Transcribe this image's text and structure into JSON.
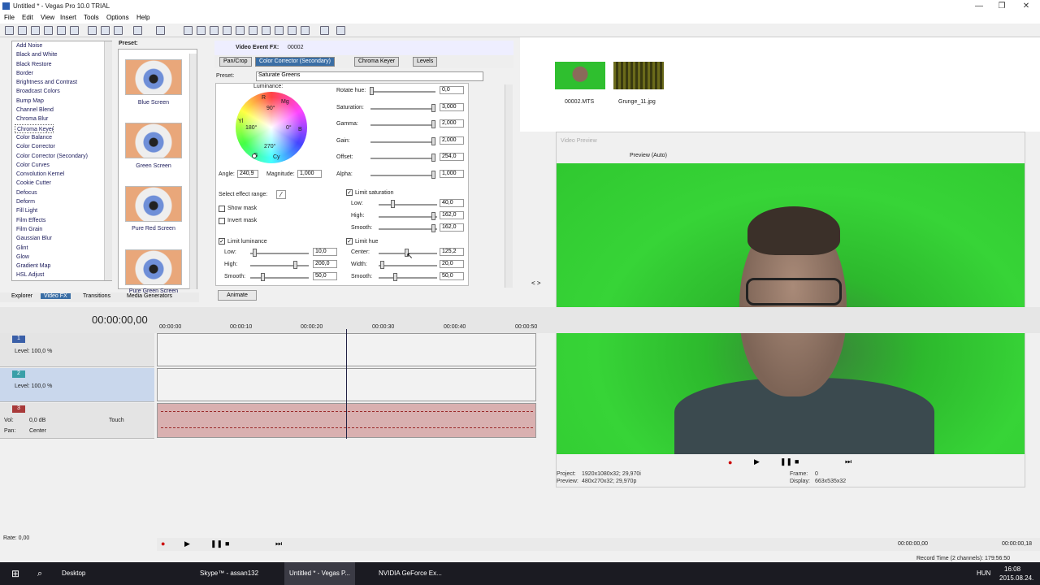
{
  "window": {
    "title": "Untitled * - Vegas Pro 10.0 TRIAL",
    "controls": [
      "—",
      "❐",
      "✕"
    ]
  },
  "menu": [
    "File",
    "Edit",
    "View",
    "Insert",
    "Tools",
    "Options",
    "Help"
  ],
  "fx_list": [
    "Add Noise",
    "Black and White",
    "Black Restore",
    "Border",
    "Brightness and Contrast",
    "Broadcast Colors",
    "Bump Map",
    "Channel Blend",
    "Chroma Blur",
    "Chroma Keyer",
    "Color Balance",
    "Color Corrector",
    "Color Corrector (Secondary)",
    "Color Curves",
    "Convolution Kernel",
    "Cookie Cutter",
    "Defocus",
    "Deform",
    "Fill Light",
    "Film Effects",
    "Film Grain",
    "Gaussian Blur",
    "Glint",
    "Glow",
    "Gradient Map",
    "HSL Adjust"
  ],
  "fx_list_selected": 9,
  "preset_panel": {
    "label": "Preset:",
    "items": [
      "Blue Screen",
      "Green Screen",
      "Pure Red Screen",
      "Pure Green Screen"
    ]
  },
  "bottom_tabs": [
    "Explorer",
    "Video FX",
    "Transitions",
    "Media Generators"
  ],
  "fx_window": {
    "header": "Video Event FX:",
    "event_name": "00002",
    "tabs": [
      "Pan/Crop",
      "Color Corrector (Secondary)",
      "Chroma Keyer",
      "Levels"
    ],
    "preset_label": "Preset:",
    "preset_value": "Saturate Greens",
    "luminance_label": "Luminance:",
    "wheel_marks": {
      "r": "R",
      "mg": "Mg",
      "b": "B",
      "cy": "Cy",
      "g": "G",
      "yl": "Yl",
      "d90": "90°",
      "d180": "180°",
      "d0": "0°",
      "d270": "270°"
    },
    "angle_label": "Angle:",
    "angle_value": "240,9",
    "magnitude_label": "Magnitude:",
    "magnitude_value": "1,000",
    "sliders": [
      {
        "label": "Rotate hue:",
        "value": "0,0",
        "level": 0.0
      },
      {
        "label": "Saturation:",
        "value": "3,000",
        "level": 1.0
      },
      {
        "label": "Gamma:",
        "value": "2,000",
        "level": 1.0
      },
      {
        "label": "Gain:",
        "value": "2,000",
        "level": 1.0
      },
      {
        "label": "Offset:",
        "value": "254,0",
        "level": 1.0
      },
      {
        "label": "Alpha:",
        "value": "1,000",
        "level": 1.0
      }
    ],
    "select_effect_range": "Select effect range:",
    "show_mask": "Show mask",
    "invert_mask": "Invert mask",
    "limit_luminance": "Limit luminance",
    "lum": [
      {
        "label": "Low:",
        "value": "10,0"
      },
      {
        "label": "High:",
        "value": "200,0"
      },
      {
        "label": "Smooth:",
        "value": "50,0"
      }
    ],
    "limit_saturation": "Limit saturation",
    "sat": [
      {
        "label": "Low:",
        "value": "40,0"
      },
      {
        "label": "High:",
        "value": "162,0"
      },
      {
        "label": "Smooth:",
        "value": "162,0"
      }
    ],
    "limit_hue": "Limit hue",
    "hue": [
      {
        "label": "Center:",
        "value": "125,2"
      },
      {
        "label": "Width:",
        "value": "20,0"
      },
      {
        "label": "Smooth:",
        "value": "50,0"
      }
    ],
    "animate": "Animate"
  },
  "media": [
    {
      "name": "00002.MTS"
    },
    {
      "name": "Grunge_11.jpg"
    }
  ],
  "preview": {
    "title": "Video Preview",
    "mode": "Preview (Auto)",
    "project_label": "Project:",
    "project_value": "1920x1080x32; 29,970i",
    "preview_label": "Preview:",
    "preview_value": "480x270x32; 29,970p",
    "frame_label": "Frame:",
    "frame_value": "0",
    "display_label": "Display:",
    "display_value": "663x535x32"
  },
  "timeline": {
    "time": "00:00:00,00",
    "marks": [
      "00:00:00",
      "00:00:10",
      "00:00:20",
      "00:00:30",
      "00:00:40",
      "00:00:50"
    ],
    "tracks": [
      {
        "num": "1",
        "level": "Level: 100,0 %"
      },
      {
        "num": "2",
        "level": "Level: 100,0 %"
      },
      {
        "num": "3",
        "vol": "Vol:",
        "vol_value": "0,0 dB",
        "pan": "Pan:",
        "pan_value": "Center",
        "touch": "Touch"
      }
    ],
    "rate": "Rate: 0,00",
    "end_time_1": "00:00:00,00",
    "end_time_2": "00:00:00,18",
    "record_time": "Record Time (2 channels): 179:56:50"
  },
  "taskbar": {
    "items": [
      "Desktop",
      "Skype™ - assan132",
      "Untitled * - Vegas P...",
      "NVIDIA GeForce Ex..."
    ],
    "lang": "HUN",
    "clock_time": "16:08",
    "clock_date": "2015.08.24."
  },
  "colors": {
    "accent": "#3a6ea5",
    "green_screen": "#33cc33"
  }
}
